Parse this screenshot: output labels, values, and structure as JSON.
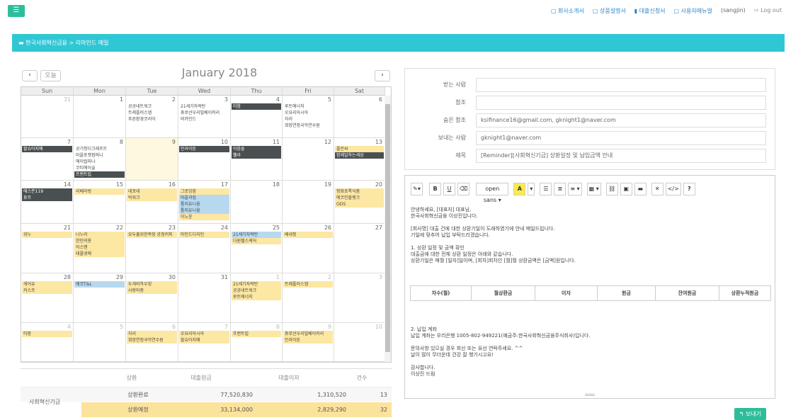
{
  "topbar": {
    "menu_icon": "menu-icon",
    "links": [
      {
        "label": "회사소개서",
        "icon": "document-icon"
      },
      {
        "label": "상품설명서",
        "icon": "document-icon"
      },
      {
        "label": "대출신청서",
        "icon": "file-icon"
      },
      {
        "label": "사용자매뉴얼",
        "icon": "document-icon"
      }
    ],
    "user": "(sangjin)",
    "logout": "Log out"
  },
  "breadcrumb": "한국사회혁신금융 > 리마인드 메일",
  "calendar": {
    "prev": "‹",
    "today": "오늘",
    "next": "›",
    "month_title": "January 2018",
    "days": [
      "Sun",
      "Mon",
      "Tue",
      "Wed",
      "Thu",
      "Fri",
      "Sat"
    ],
    "dates": [
      [
        "31",
        "1",
        "2",
        "3",
        "4",
        "5",
        "6"
      ],
      [
        "7",
        "8",
        "9",
        "10",
        "11",
        "12",
        "13"
      ],
      [
        "14",
        "15",
        "16",
        "17",
        "18",
        "19",
        "20"
      ],
      [
        "21",
        "22",
        "23",
        "24",
        "25",
        "26",
        "27"
      ],
      [
        "28",
        "29",
        "30",
        "31",
        "1",
        "2",
        "3"
      ],
      [
        "4",
        "5",
        "6",
        "7",
        "8",
        "9",
        "10"
      ]
    ],
    "events": {
      "w0d2": [
        "공공네트워크",
        "트레플러스엡",
        "푸른환경코리아"
      ],
      "w0d3": [
        "21세기자락탄",
        "휴로선우리빌베이커리",
        "비카인드"
      ],
      "w0d4": [
        "티팜"
      ],
      "w0d5": [
        "루트에너지",
        "오요리아시아",
        "자리",
        "희망연정국악연수원"
      ],
      "w1d0": [
        "할슈아지매"
      ],
      "w1d1": [
        "공기청디크래프트",
        "마을포켓컴퍼니",
        "에이럽피나",
        "코티에이슬",
        "프랜트립"
      ],
      "w1d3": [
        "인라이튼"
      ],
      "w1d4": [
        "이음숲",
        "웰라"
      ],
      "w1d6": [
        "플린씨",
        "함께일하는세상"
      ],
      "w2d0": [
        "에스존119",
        "휴프"
      ],
      "w2d1": [
        "리베라빗"
      ],
      "w2d2": [
        "네포네",
        "빅워크"
      ],
      "w2d3": [
        "그로잉맘",
        "마을과집",
        "톺지유니움",
        "톺지유니움",
        "이노윤"
      ],
      "w2d6": [
        "청화초록식품",
        "에코인블랭크",
        "ODS"
      ],
      "w3d0": [
        "위누"
      ],
      "w3d1": [
        "나누리",
        "한인의용",
        "어스맨",
        "테플넷애"
      ],
      "w3d2": [
        "요두출위한족장 공정커피"
      ],
      "w3d3": [
        "마인드디자인"
      ],
      "w3d4": [
        "21세기자락탄",
        "다원헬스케어"
      ],
      "w3d5": [
        "베네핏"
      ],
      "w4d0": [
        "캐어유",
        "커스프"
      ],
      "w4d1": [
        "에코T&L"
      ],
      "w4d2": [
        "두개비하우징",
        "사랑마중"
      ],
      "w4d4": [
        "21세기자락탄",
        "공공네트워크",
        "루트에너지"
      ],
      "w4d5": [
        "트레플러스엡"
      ],
      "w5d0": [
        "티팜"
      ],
      "w5d2": [
        "자리",
        "희망연정국악연수원"
      ],
      "w5d3": [
        "오요리아시아",
        "할슈아지매"
      ],
      "w5d4": [
        "프랜트립"
      ],
      "w5d5": [
        "휴로선우리빌베이커리",
        "인라이튼"
      ]
    }
  },
  "summary": {
    "headers": [
      "상환",
      "대출원금",
      "대출이자",
      "건수"
    ],
    "group": "사회혁신기금",
    "rows": [
      {
        "label": "상환완료",
        "principal": "77,520,830",
        "interest": "1,310,520",
        "count": "13"
      },
      {
        "label": "상환예정",
        "principal": "33,134,000",
        "interest": "2,829,290",
        "count": "32"
      }
    ]
  },
  "mail": {
    "to_label": "받는 사람",
    "to": "",
    "cc_label": "참조",
    "cc": "",
    "bcc_label": "숨은 참조",
    "bcc": "ksifinance16@gmail.com, gknight1@naver.com",
    "from_label": "보내는 사람",
    "from": "gknight1@naver.com",
    "subject_label": "제목",
    "subject": "[Reminder][사회혁신기금] 상환일정 및 납입금액 안내"
  },
  "editor": {
    "toolbar": {
      "magic": "✎▾",
      "bold": "B",
      "underline": "U",
      "eraser": "⌫",
      "font": "open sans ▾",
      "color": "A",
      "color_drop": "▾",
      "ul": "☰",
      "ol": "≣",
      "align": "≡ ▾",
      "table": "▦ ▾",
      "link": "⛓",
      "image": "▣",
      "hr": "▬",
      "fullscreen": "✕",
      "code": "</>",
      "help": "?"
    },
    "lines": [
      "안녕하세요, [대표자] 대표님,",
      "한국사회혁신금융 이상진입니다.",
      "",
      "[회사명] 대출 건에 대한 상환기일이 도래하였기에 안내 메일드립니다.",
      "기일에 맞추어 납입 부탁드리겠습니다.",
      "",
      "1. 상환 일정 및 금액 확인",
      "대출금에 대한 전체 상환 일정은 아래와 같습니다.",
      "상환기일은 매월 [일자]일이며, [회차]회차인 [월]월 상환금액은 [금액]원입니다."
    ],
    "table_headers": [
      "차수(월)",
      "월상환금",
      "이자",
      "원금",
      "잔여원금",
      "상환누적원금"
    ],
    "lines2": [
      "2. 납입 계좌",
      "납입 계좌는 우리은행 1005-802-949221(예금주:한국사회혁신금융주식회사)입니다.",
      "",
      "문의사항 있으실 경우 회신 또는 유선 연락주세요. ^^",
      "날이 많이 무더운데 건강 잘 챙기시고요!",
      "",
      "감사합니다.",
      "이상진 드림"
    ]
  },
  "send": "보내기"
}
